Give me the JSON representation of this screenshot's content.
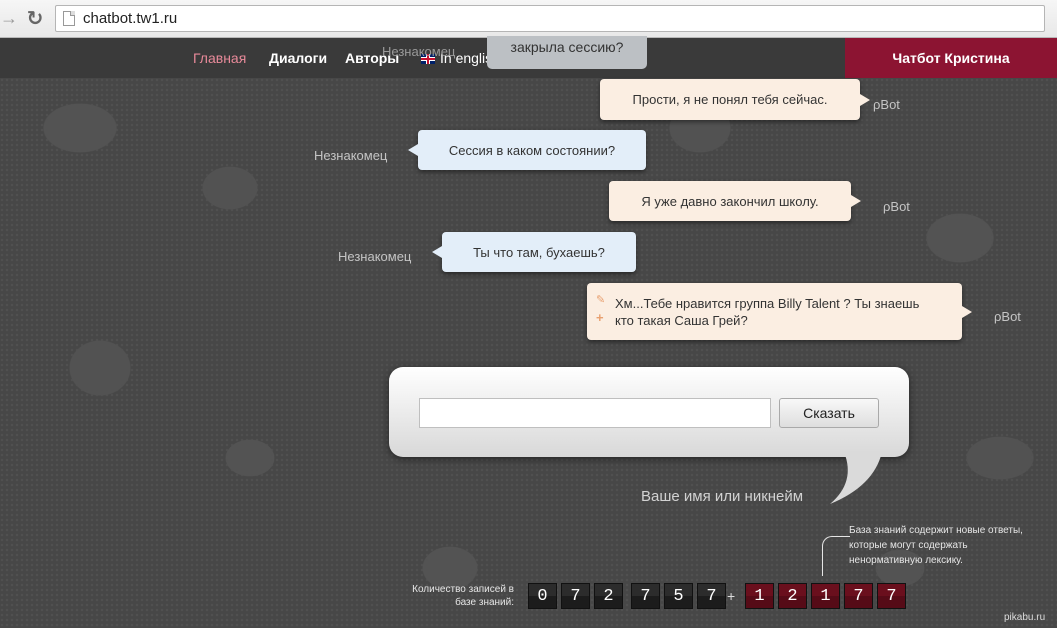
{
  "browser": {
    "url": "chatbot.tw1.ru"
  },
  "nav": {
    "items": [
      "Главная",
      "Диалоги",
      "Авторы",
      "In english"
    ],
    "brand": "Чатбот Кристина"
  },
  "chat": {
    "ghost_speaker": "Незнакомец",
    "ghost_message": "закрыла сессию?",
    "messages": [
      {
        "from": "bot",
        "speaker": "ρBot",
        "text": "Прости, я не понял тебя сейчас."
      },
      {
        "from": "user",
        "speaker": "Незнакомец",
        "text": "Сессия в каком состоянии?"
      },
      {
        "from": "bot",
        "speaker": "ρBot",
        "text": "Я уже давно закончил школу."
      },
      {
        "from": "user",
        "speaker": "Незнакомец",
        "text": "Ты что там, бухаешь?"
      },
      {
        "from": "bot",
        "speaker": "ρBot",
        "text_line1": "Хм...Тебе нравится группа Billy Talent ? Ты знаешь",
        "text_line2": "кто такая Саша Грей?"
      }
    ]
  },
  "form": {
    "input_value": "",
    "say_button": "Сказать",
    "nickname_hint": "Ваше имя или никнейм"
  },
  "kb": {
    "note": "База знаний содержит новые ответы, которые могут содержать ненормативную лексику.",
    "label": "Количество записей в базе знаний:",
    "digits_main": [
      "0",
      "7",
      "2",
      "7",
      "5",
      "7"
    ],
    "separator": "+",
    "digits_new": [
      "1",
      "2",
      "1",
      "7",
      "7"
    ]
  },
  "watermark": "pikabu.ru",
  "colors": {
    "brand": "#8c1432",
    "nav_active": "#e88a9a",
    "bot_bubble": "#fbeee2",
    "user_bubble": "#e3eef9"
  }
}
